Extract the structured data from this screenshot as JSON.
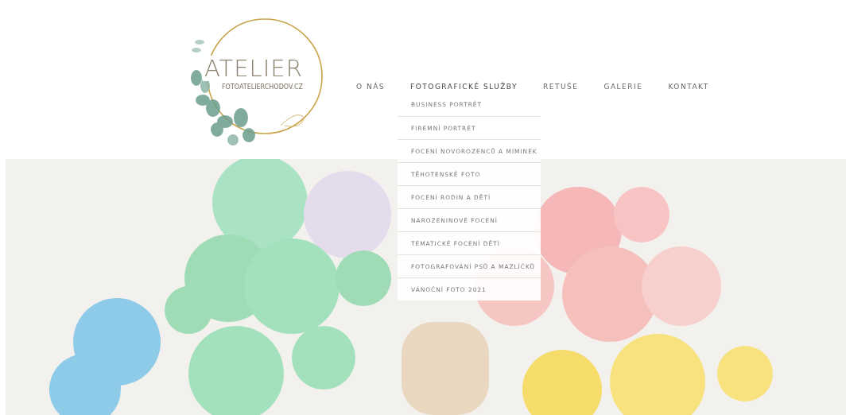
{
  "logo": {
    "title": "ATELIER",
    "subtitle": "FOTOATELIERCHODOV.CZ"
  },
  "nav": {
    "items": [
      {
        "label": "O NÁS",
        "expanded": false
      },
      {
        "label": "FOTOGRAFICKÉ SLUŽBY",
        "expanded": true,
        "children": [
          {
            "label": "BUSINESS PORTRÉT"
          },
          {
            "label": "FIREMNÍ PORTRÉT"
          },
          {
            "label": "FOCENÍ NOVOROZENCŮ A MIMINEK"
          },
          {
            "label": "TĚHOTENSKÉ FOTO"
          },
          {
            "label": "FOCENÍ RODIN A DĚTÍ"
          },
          {
            "label": "NAROZENINOVÉ FOCENÍ"
          },
          {
            "label": "TEMATICKÉ FOCENÍ DĚTÍ"
          },
          {
            "label": "FOTOGRAFOVÁNÍ PSŮ A MAZLÍČKŮ"
          },
          {
            "label": "VÁNOČNÍ FOTO 2021"
          }
        ]
      },
      {
        "label": "RETUŠE",
        "expanded": false
      },
      {
        "label": "GALERIE",
        "expanded": false
      },
      {
        "label": "KONTAKT",
        "expanded": false
      }
    ]
  }
}
